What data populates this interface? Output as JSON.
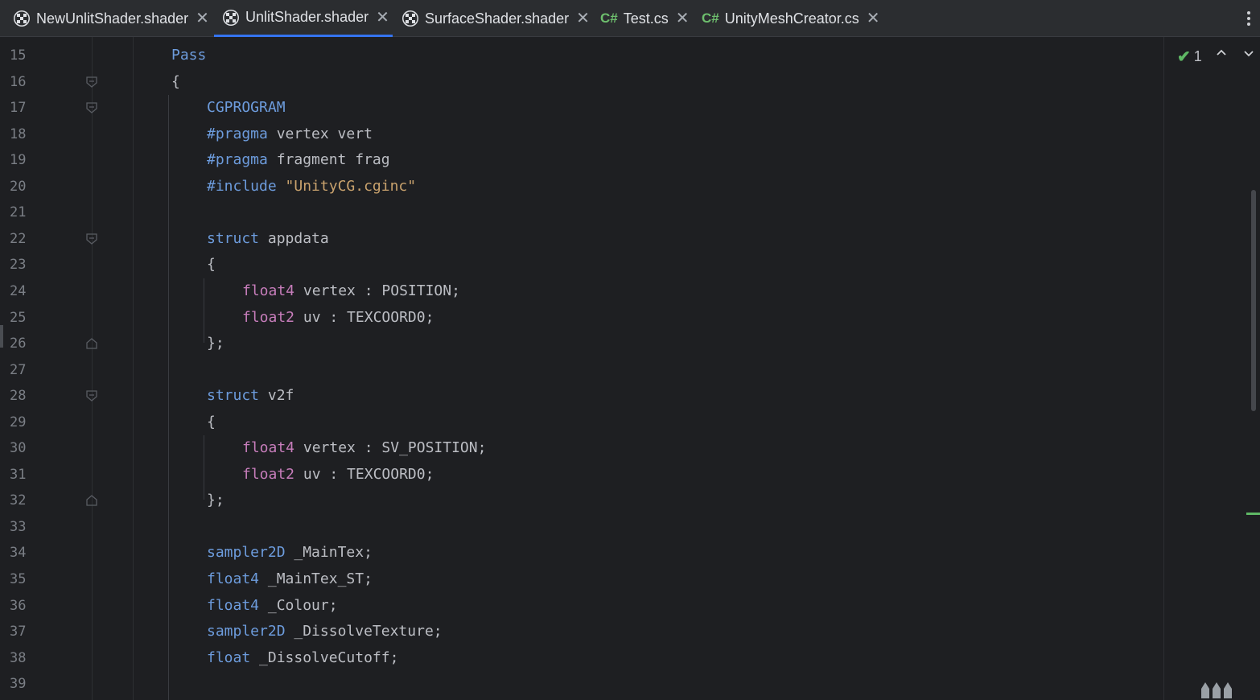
{
  "tabs": [
    {
      "label": "NewUnlitShader.shader",
      "kind": "shader-icon",
      "active": false
    },
    {
      "label": "UnlitShader.shader",
      "kind": "shader-icon",
      "active": true
    },
    {
      "label": "SurfaceShader.shader",
      "kind": "shader-icon",
      "active": false
    },
    {
      "label": "Test.cs",
      "kind": "csharp-icon",
      "active": false
    },
    {
      "label": "UnityMeshCreator.cs",
      "kind": "csharp-icon",
      "active": false
    }
  ],
  "csharp_badge": "C#",
  "close_glyph": "✕",
  "inspection": {
    "count": "1",
    "status_icon": "check-icon"
  },
  "colors": {
    "accent": "#3574f0",
    "keyword": "#6d9cdd",
    "type": "#c77dbb",
    "string": "#c9a26d",
    "ok": "#5fb865"
  },
  "code_lines": [
    {
      "n": "15",
      "indent": 1,
      "parts": [
        [
          "Pass",
          "kw"
        ]
      ]
    },
    {
      "n": "16",
      "indent": 1,
      "fold": "open",
      "parts": [
        [
          "{",
          "id"
        ]
      ]
    },
    {
      "n": "17",
      "indent": 2,
      "fold": "open",
      "parts": [
        [
          "CGPROGRAM",
          "kw"
        ]
      ]
    },
    {
      "n": "18",
      "indent": 2,
      "parts": [
        [
          "#pragma",
          "pre"
        ],
        [
          " vertex vert",
          "id"
        ]
      ]
    },
    {
      "n": "19",
      "indent": 2,
      "parts": [
        [
          "#pragma",
          "pre"
        ],
        [
          " fragment frag",
          "id"
        ]
      ]
    },
    {
      "n": "20",
      "indent": 2,
      "parts": [
        [
          "#include",
          "pre"
        ],
        [
          " ",
          "id"
        ],
        [
          "\"UnityCG.cginc\"",
          "str"
        ]
      ]
    },
    {
      "n": "21",
      "indent": 2,
      "parts": []
    },
    {
      "n": "22",
      "indent": 2,
      "fold": "open",
      "parts": [
        [
          "struct",
          "kw"
        ],
        [
          " appdata",
          "id"
        ]
      ]
    },
    {
      "n": "23",
      "indent": 2,
      "parts": [
        [
          "{",
          "id"
        ]
      ]
    },
    {
      "n": "24",
      "indent": 3,
      "parts": [
        [
          "float4",
          "type"
        ],
        [
          " vertex : POSITION;",
          "id"
        ]
      ]
    },
    {
      "n": "25",
      "indent": 3,
      "parts": [
        [
          "float2",
          "type"
        ],
        [
          " uv : TEXCOORD0;",
          "id"
        ]
      ]
    },
    {
      "n": "26",
      "indent": 2,
      "fold": "close",
      "parts": [
        [
          "};",
          "id"
        ]
      ]
    },
    {
      "n": "27",
      "indent": 2,
      "parts": []
    },
    {
      "n": "28",
      "indent": 2,
      "fold": "open",
      "parts": [
        [
          "struct",
          "kw"
        ],
        [
          " v2f",
          "id"
        ]
      ]
    },
    {
      "n": "29",
      "indent": 2,
      "parts": [
        [
          "{",
          "id"
        ]
      ]
    },
    {
      "n": "30",
      "indent": 3,
      "parts": [
        [
          "float4",
          "type"
        ],
        [
          " vertex : SV_POSITION;",
          "id"
        ]
      ]
    },
    {
      "n": "31",
      "indent": 3,
      "parts": [
        [
          "float2",
          "type"
        ],
        [
          " uv : TEXCOORD0;",
          "id"
        ]
      ]
    },
    {
      "n": "32",
      "indent": 2,
      "fold": "close",
      "parts": [
        [
          "};",
          "id"
        ]
      ]
    },
    {
      "n": "33",
      "indent": 2,
      "parts": []
    },
    {
      "n": "34",
      "indent": 2,
      "parts": [
        [
          "sampler2D",
          "kw"
        ],
        [
          " _MainTex;",
          "id"
        ]
      ]
    },
    {
      "n": "35",
      "indent": 2,
      "parts": [
        [
          "float4",
          "kw"
        ],
        [
          " _MainTex_ST;",
          "id"
        ]
      ]
    },
    {
      "n": "36",
      "indent": 2,
      "parts": [
        [
          "float4",
          "kw"
        ],
        [
          " _Colour;",
          "id"
        ]
      ]
    },
    {
      "n": "37",
      "indent": 2,
      "parts": [
        [
          "sampler2D",
          "kw"
        ],
        [
          " _DissolveTexture;",
          "id"
        ]
      ]
    },
    {
      "n": "38",
      "indent": 2,
      "parts": [
        [
          "float",
          "kw"
        ],
        [
          " _DissolveCutoff;",
          "id"
        ]
      ]
    },
    {
      "n": "39",
      "indent": 2,
      "parts": []
    }
  ]
}
